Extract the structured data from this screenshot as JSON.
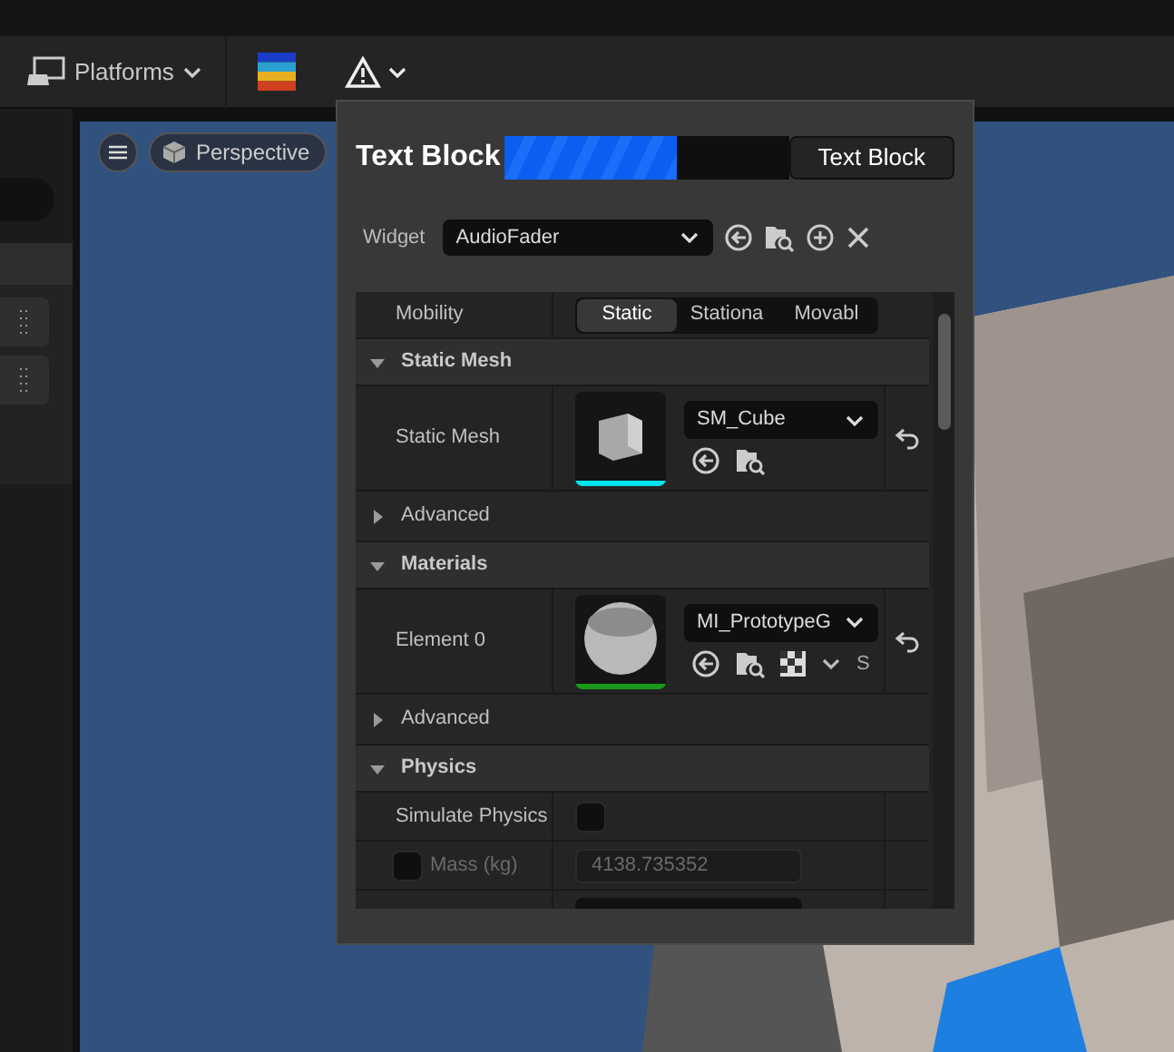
{
  "toolbar": {
    "platforms_label": "Platforms"
  },
  "viewport": {
    "view_mode": "Perspective"
  },
  "popup": {
    "title": "Text Block",
    "progress": {
      "level": 0.61
    },
    "button": "Text Block",
    "widget_label": "Widget",
    "widget_value": "AudioFader"
  },
  "details": {
    "mobility": {
      "label": "Mobility",
      "options": [
        {
          "label": "Static",
          "selected": true
        },
        {
          "label": "Stationa",
          "selected": false
        },
        {
          "label": "Movabl",
          "selected": false
        }
      ]
    },
    "sections": [
      {
        "title": "Static Mesh",
        "expanded": true,
        "rows": [
          {
            "kind": "asset",
            "label": "Static Mesh",
            "value": "SM_Cube",
            "thumb": {
              "kind": "cube"
            },
            "color": "#00e5ee"
          },
          {
            "kind": "group",
            "label": "Advanced",
            "expanded": false
          }
        ]
      },
      {
        "title": "Materials",
        "expanded": true,
        "rows": [
          {
            "kind": "asset",
            "label": "Element 0",
            "value": "MI_PrototypeG",
            "thumb": {
              "kind": "sphere"
            },
            "color": "#1a9a1a",
            "trailing": "S"
          },
          {
            "kind": "group",
            "label": "Advanced",
            "expanded": false
          }
        ]
      },
      {
        "title": "Physics",
        "expanded": true,
        "rows": [
          {
            "kind": "checkbox",
            "label": "Simulate Physics",
            "checked": false
          },
          {
            "kind": "number",
            "label": "Mass (kg)",
            "checked": false,
            "value": "4138.735352",
            "disabled": true
          },
          {
            "kind": "blank"
          }
        ]
      }
    ]
  }
}
